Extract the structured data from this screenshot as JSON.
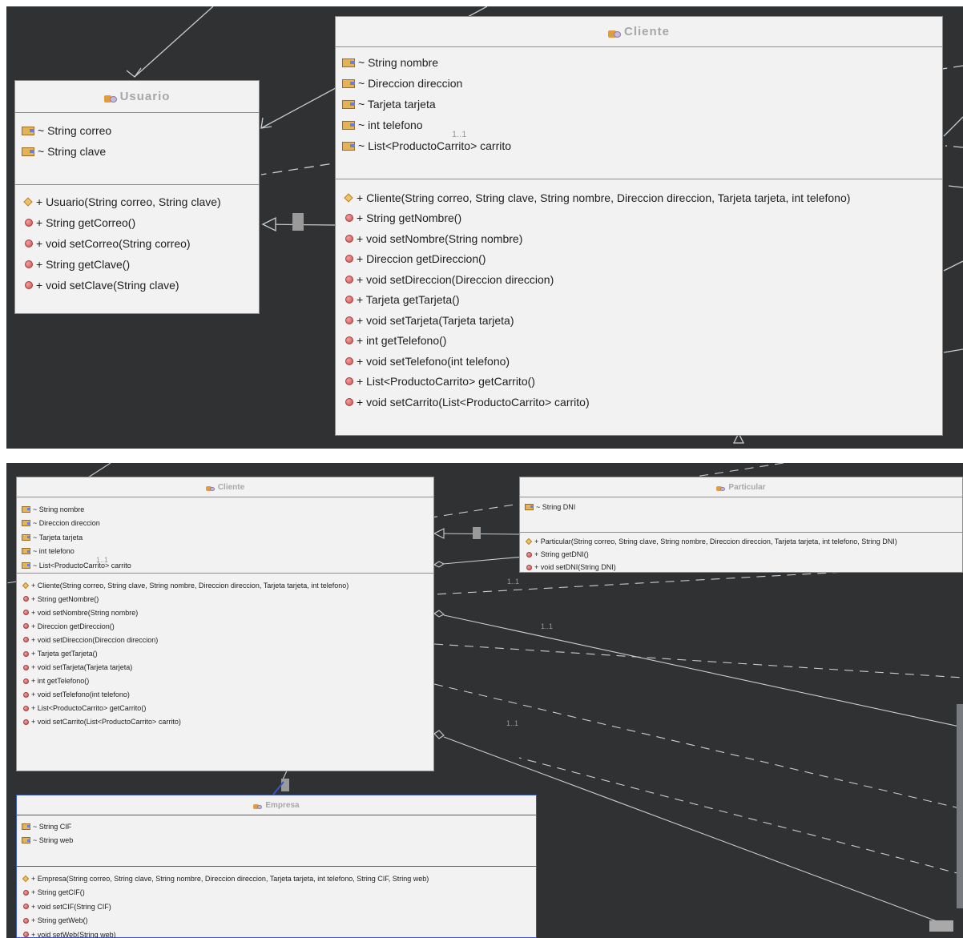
{
  "top": {
    "cliente": {
      "title": "Cliente",
      "attributes": [
        "~ String nombre",
        "~ Direccion direccion",
        "~ Tarjeta tarjeta",
        "~ int telefono",
        "~ List<ProductoCarrito> carrito"
      ],
      "methods": [
        "+ Cliente(String correo, String clave, String nombre, Direccion direccion, Tarjeta tarjeta, int telefono)",
        "+ String getNombre()",
        "+ void setNombre(String nombre)",
        "+ Direccion getDireccion()",
        "+ void setDireccion(Direccion direccion)",
        "+ Tarjeta getTarjeta()",
        "+ void setTarjeta(Tarjeta tarjeta)",
        "+ int getTelefono()",
        "+ void setTelefono(int telefono)",
        "+ List<ProductoCarrito> getCarrito()",
        "+ void setCarrito(List<ProductoCarrito> carrito)"
      ]
    },
    "usuario": {
      "title": "Usuario",
      "attributes": [
        "~ String correo",
        "~ String clave"
      ],
      "methods": [
        "+ Usuario(String correo, String clave)",
        "+ String getCorreo()",
        "+ void setCorreo(String correo)",
        "+ String getClave()",
        "+ void setClave(String clave)"
      ]
    },
    "multiplicity": "1..1"
  },
  "bottom": {
    "cliente": {
      "title": "Cliente",
      "attributes": [
        "~ String nombre",
        "~ Direccion direccion",
        "~ Tarjeta tarjeta",
        "~ int telefono",
        "~ List<ProductoCarrito> carrito"
      ],
      "methods": [
        "+ Cliente(String correo, String clave, String nombre, Direccion direccion, Tarjeta tarjeta, int telefono)",
        "+ String getNombre()",
        "+ void setNombre(String nombre)",
        "+ Direccion getDireccion()",
        "+ void setDireccion(Direccion direccion)",
        "+ Tarjeta getTarjeta()",
        "+ void setTarjeta(Tarjeta tarjeta)",
        "+ int getTelefono()",
        "+ void setTelefono(int telefono)",
        "+ List<ProductoCarrito> getCarrito()",
        "+ void setCarrito(List<ProductoCarrito> carrito)"
      ]
    },
    "particular": {
      "title": "Particular",
      "attributes": [
        "~ String DNI"
      ],
      "methods": [
        "+ Particular(String correo, String clave, String nombre, Direccion direccion, Tarjeta tarjeta, int telefono, String DNI)",
        "+ String getDNI()",
        "+ void setDNI(String DNI)"
      ]
    },
    "empresa": {
      "title": "Empresa",
      "attributes": [
        "~ String CIF",
        "~ String web"
      ],
      "methods": [
        "+ Empresa(String correo, String clave, String nombre, Direccion direccion, Tarjeta tarjeta, int telefono, String CIF, String web)",
        "+ String getCIF()",
        "+ void setCIF(String CIF)",
        "+ String getWeb()",
        "+ void setWeb(String web)"
      ]
    },
    "multiplicities": [
      "1..1",
      "1..1",
      "1..1",
      "1..1"
    ]
  },
  "colors": {
    "canvas": "#2f3133",
    "box": "#f2f2f2",
    "border": "#8d8d8d",
    "selected": "#3a56c5",
    "line": "#b8bcbf"
  }
}
